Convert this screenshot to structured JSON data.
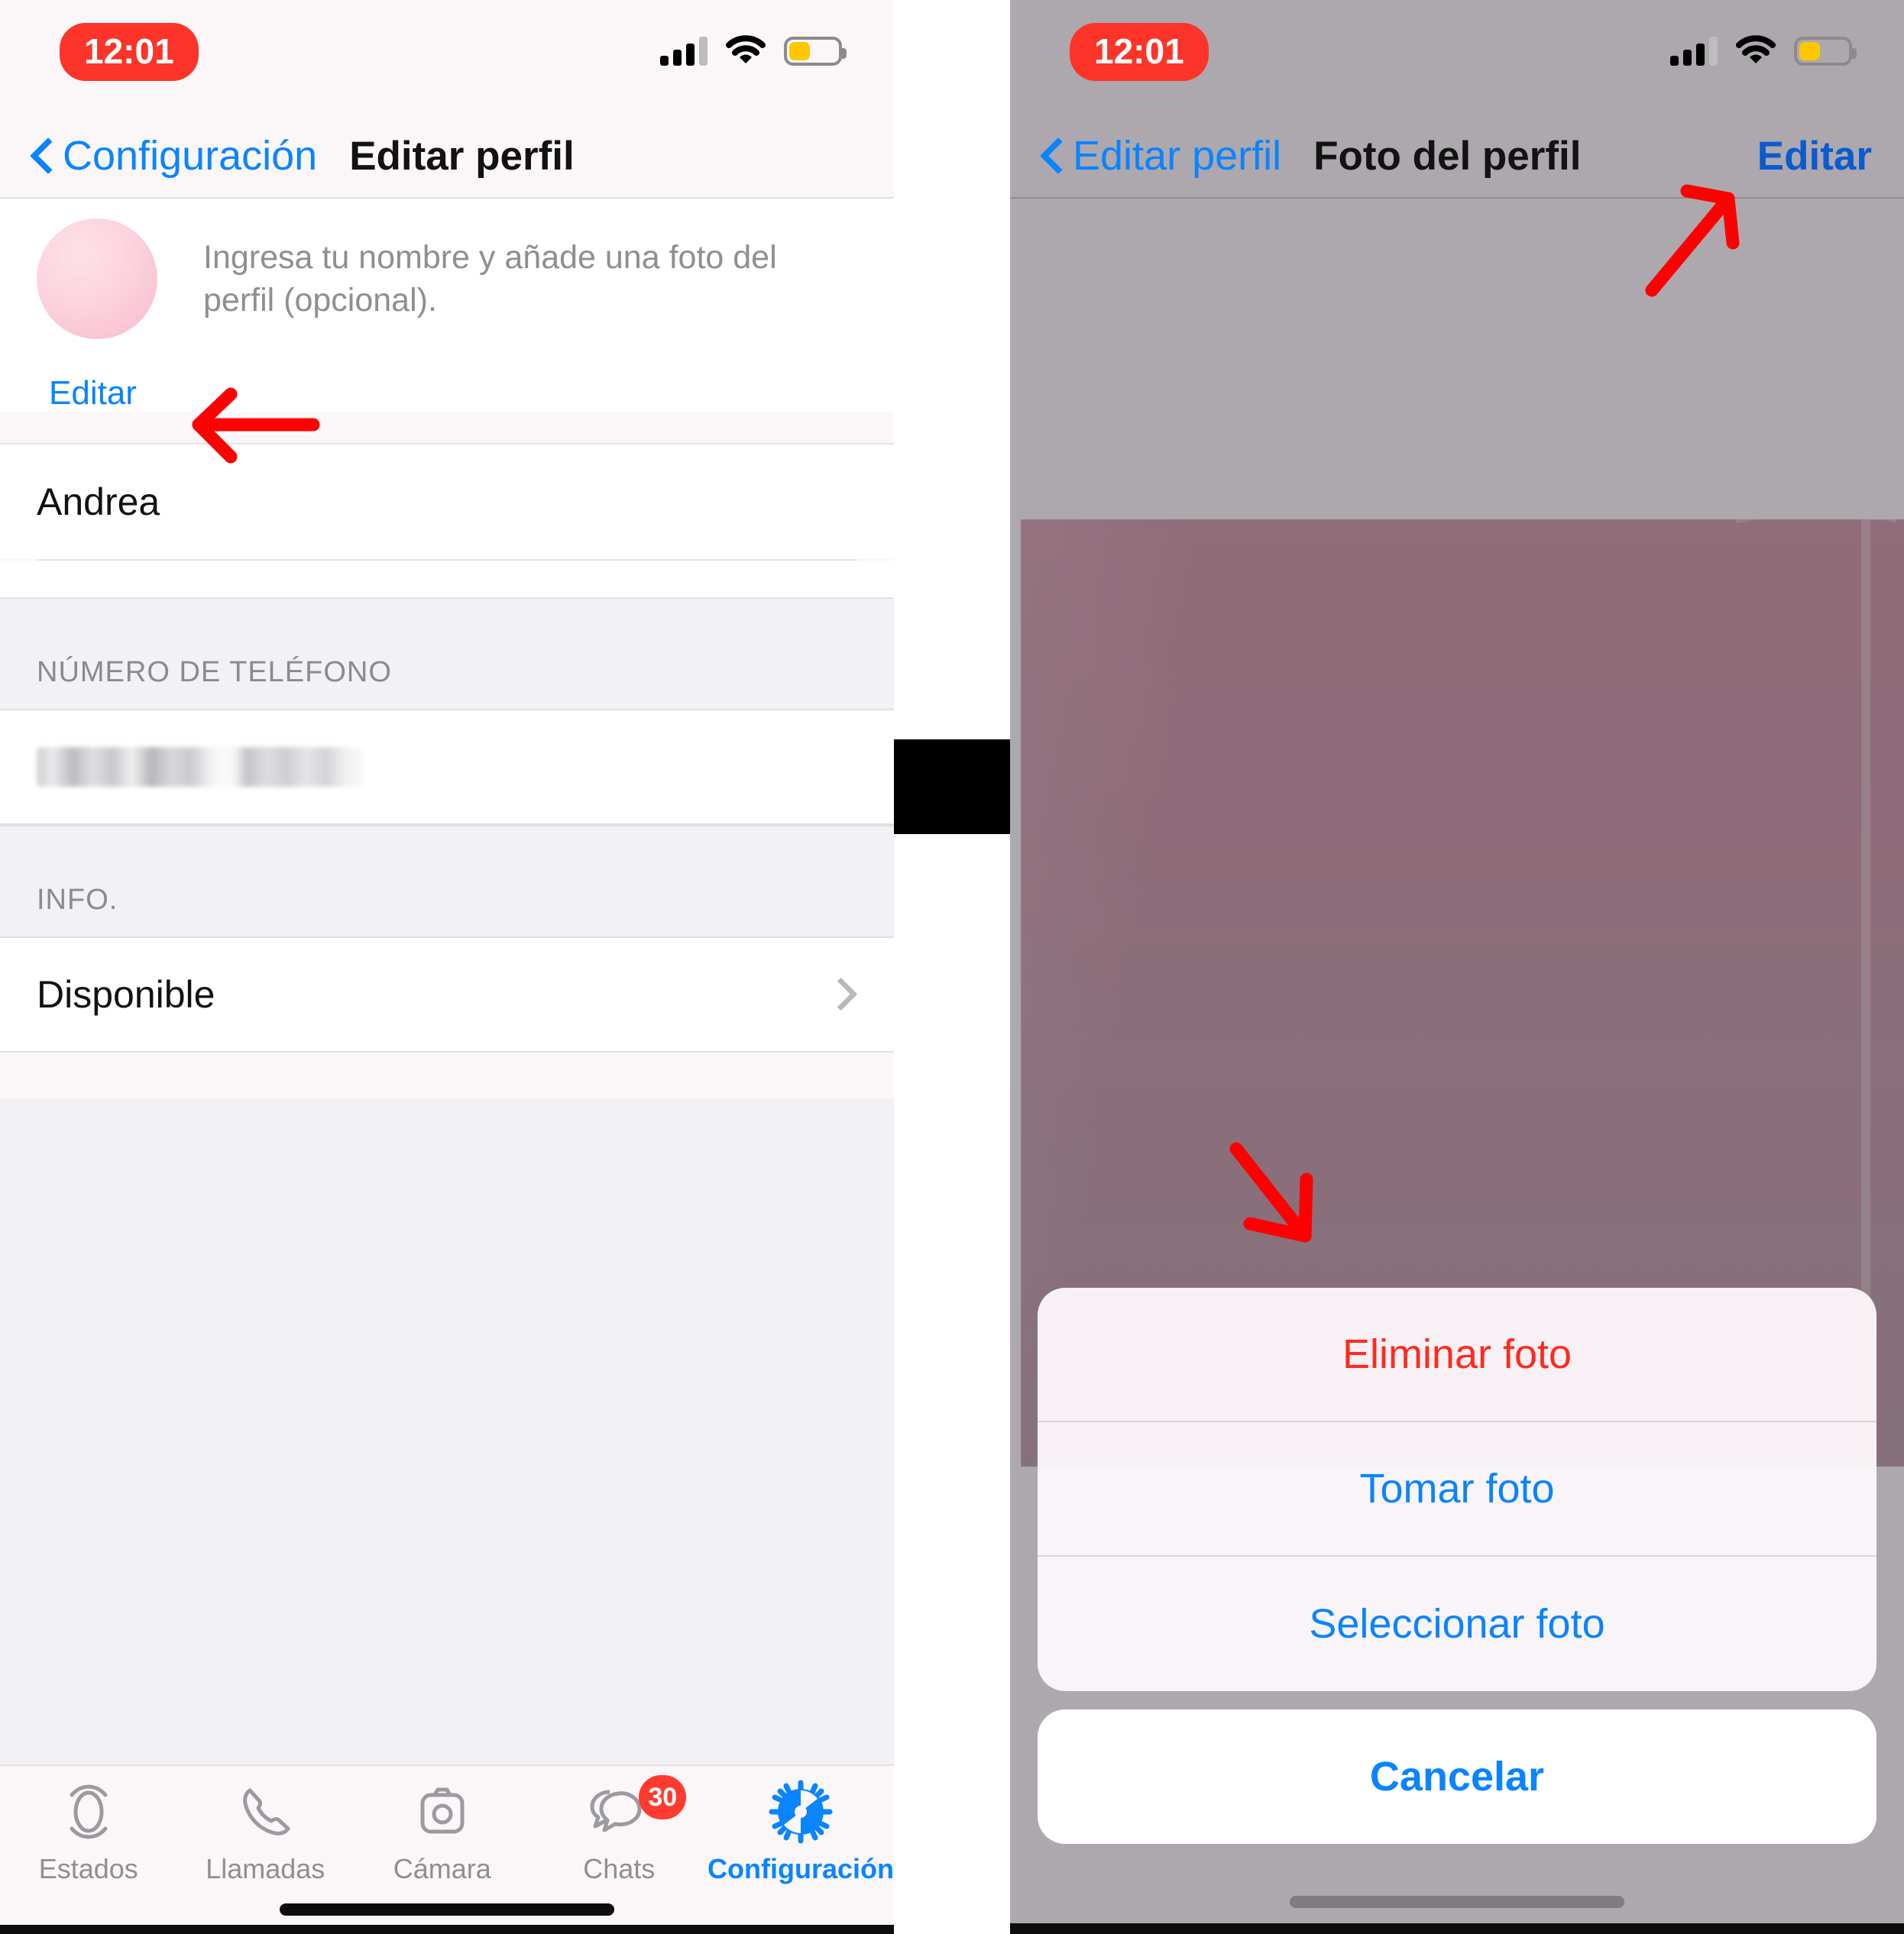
{
  "left_panel": {
    "status_bar": {
      "time": "12:01",
      "cellular_icon": "cellular-bars-icon",
      "wifi_icon": "wifi-icon",
      "battery_icon": "battery-low-power-icon"
    },
    "nav": {
      "back_label": "Configuración",
      "title": "Editar perfil",
      "back_icon": "chevron-left-icon"
    },
    "profile": {
      "hint": "Ingresa tu nombre y añade una foto del perfil (opcional).",
      "edit_label": "Editar",
      "avatar_name": "avatar",
      "name_value": "Andrea"
    },
    "sections": [
      {
        "header": "NÚMERO DE TELÉFONO",
        "value": "",
        "redacted": true,
        "chevron": false
      },
      {
        "header": "INFO.",
        "value": "Disponible",
        "redacted": false,
        "chevron": true
      }
    ],
    "tabbar": {
      "items": [
        {
          "label": "Estados",
          "icon": "status-rings-icon",
          "active": false,
          "badge": ""
        },
        {
          "label": "Llamadas",
          "icon": "phone-icon",
          "active": false,
          "badge": ""
        },
        {
          "label": "Cámara",
          "icon": "camera-icon",
          "active": false,
          "badge": ""
        },
        {
          "label": "Chats",
          "icon": "chat-bubbles-icon",
          "active": false,
          "badge": "30"
        },
        {
          "label": "Configuración",
          "icon": "gear-icon",
          "active": true,
          "badge": ""
        }
      ]
    }
  },
  "right_panel": {
    "status_bar": {
      "time": "12:01",
      "cellular_icon": "cellular-bars-icon",
      "wifi_icon": "wifi-icon",
      "battery_icon": "battery-low-power-icon"
    },
    "nav": {
      "back_label": "Editar perfil",
      "title": "Foto del perfil",
      "action_label": "Editar",
      "back_icon": "chevron-left-icon"
    },
    "action_sheet": {
      "options": [
        {
          "label": "Eliminar foto",
          "style": "destructive"
        },
        {
          "label": "Tomar foto",
          "style": "default"
        },
        {
          "label": "Seleccionar foto",
          "style": "default"
        }
      ],
      "cancel_label": "Cancelar"
    }
  },
  "annotations": [
    {
      "name": "arrow-to-edit-avatar",
      "direction": "left"
    },
    {
      "name": "arrow-to-edit-action",
      "direction": "up-right"
    },
    {
      "name": "arrow-to-action-sheet",
      "direction": "down-right"
    }
  ],
  "colors": {
    "accent_blue": "#0a84ff",
    "destructive_red": "#ff2a1f",
    "badge_red": "#ff3b30",
    "time_pill_red": "#fc3429",
    "battery_yellow": "#ffc700",
    "annotation_red": "#ff0000",
    "muted_text": "#8e8e93",
    "group_bg": "#f2f1f6"
  }
}
